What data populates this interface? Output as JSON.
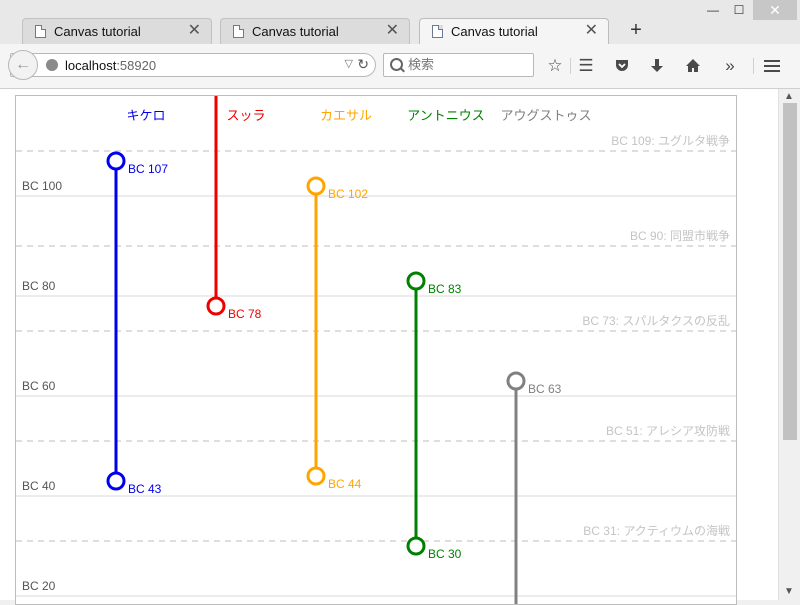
{
  "tabs": [
    {
      "title": "Canvas tutorial"
    },
    {
      "title": "Canvas tutorial"
    },
    {
      "title": "Canvas tutorial"
    }
  ],
  "toolbar": {
    "url_host": "localhost",
    "url_port": ":58920",
    "search_placeholder": "検索",
    "icons": [
      "bookmark-star-icon",
      "reading-list-icon",
      "pocket-icon",
      "download-icon",
      "home-icon",
      "overflow-chevron-icon",
      "hamburger-menu-icon"
    ]
  },
  "chart_data": {
    "type": "timeline",
    "ylim": [
      20,
      116
    ],
    "y_ticks": [
      {
        "value": 100,
        "label": "BC 100"
      },
      {
        "value": 80,
        "label": "BC 80"
      },
      {
        "value": 60,
        "label": "BC 60"
      },
      {
        "value": 40,
        "label": "BC 40"
      },
      {
        "value": 20,
        "label": "BC 20"
      }
    ],
    "events": [
      {
        "year": 109,
        "label": "BC 109: ユグルタ戦争"
      },
      {
        "year": 90,
        "label": "BC 90: 同盟市戦争"
      },
      {
        "year": 73,
        "label": "BC 73: スパルタクスの反乱"
      },
      {
        "year": 51,
        "label": "BC 51: アレシア攻防戦"
      },
      {
        "year": 31,
        "label": "BC 31: アクティウムの海戦"
      }
    ],
    "series": [
      {
        "name": "キケロ",
        "color": "#0000ee",
        "birth": 107,
        "death": 43,
        "birth_label": "BC 107",
        "death_label": "BC 43"
      },
      {
        "name": "スッラ",
        "color": "#ee0000",
        "birth": null,
        "death": 78,
        "birth_label": "",
        "death_label": "BC 78"
      },
      {
        "name": "カエサル",
        "color": "#ffa500",
        "birth": 102,
        "death": 44,
        "birth_label": "BC 102",
        "death_label": "BC 44"
      },
      {
        "name": "アントニウス",
        "color": "#008000",
        "birth": 83,
        "death": 30,
        "birth_label": "BC 83",
        "death_label": "BC 30"
      },
      {
        "name": "アウグストゥス",
        "color": "#808080",
        "birth": 63,
        "death": null,
        "birth_label": "BC 63",
        "death_label": ""
      }
    ]
  }
}
